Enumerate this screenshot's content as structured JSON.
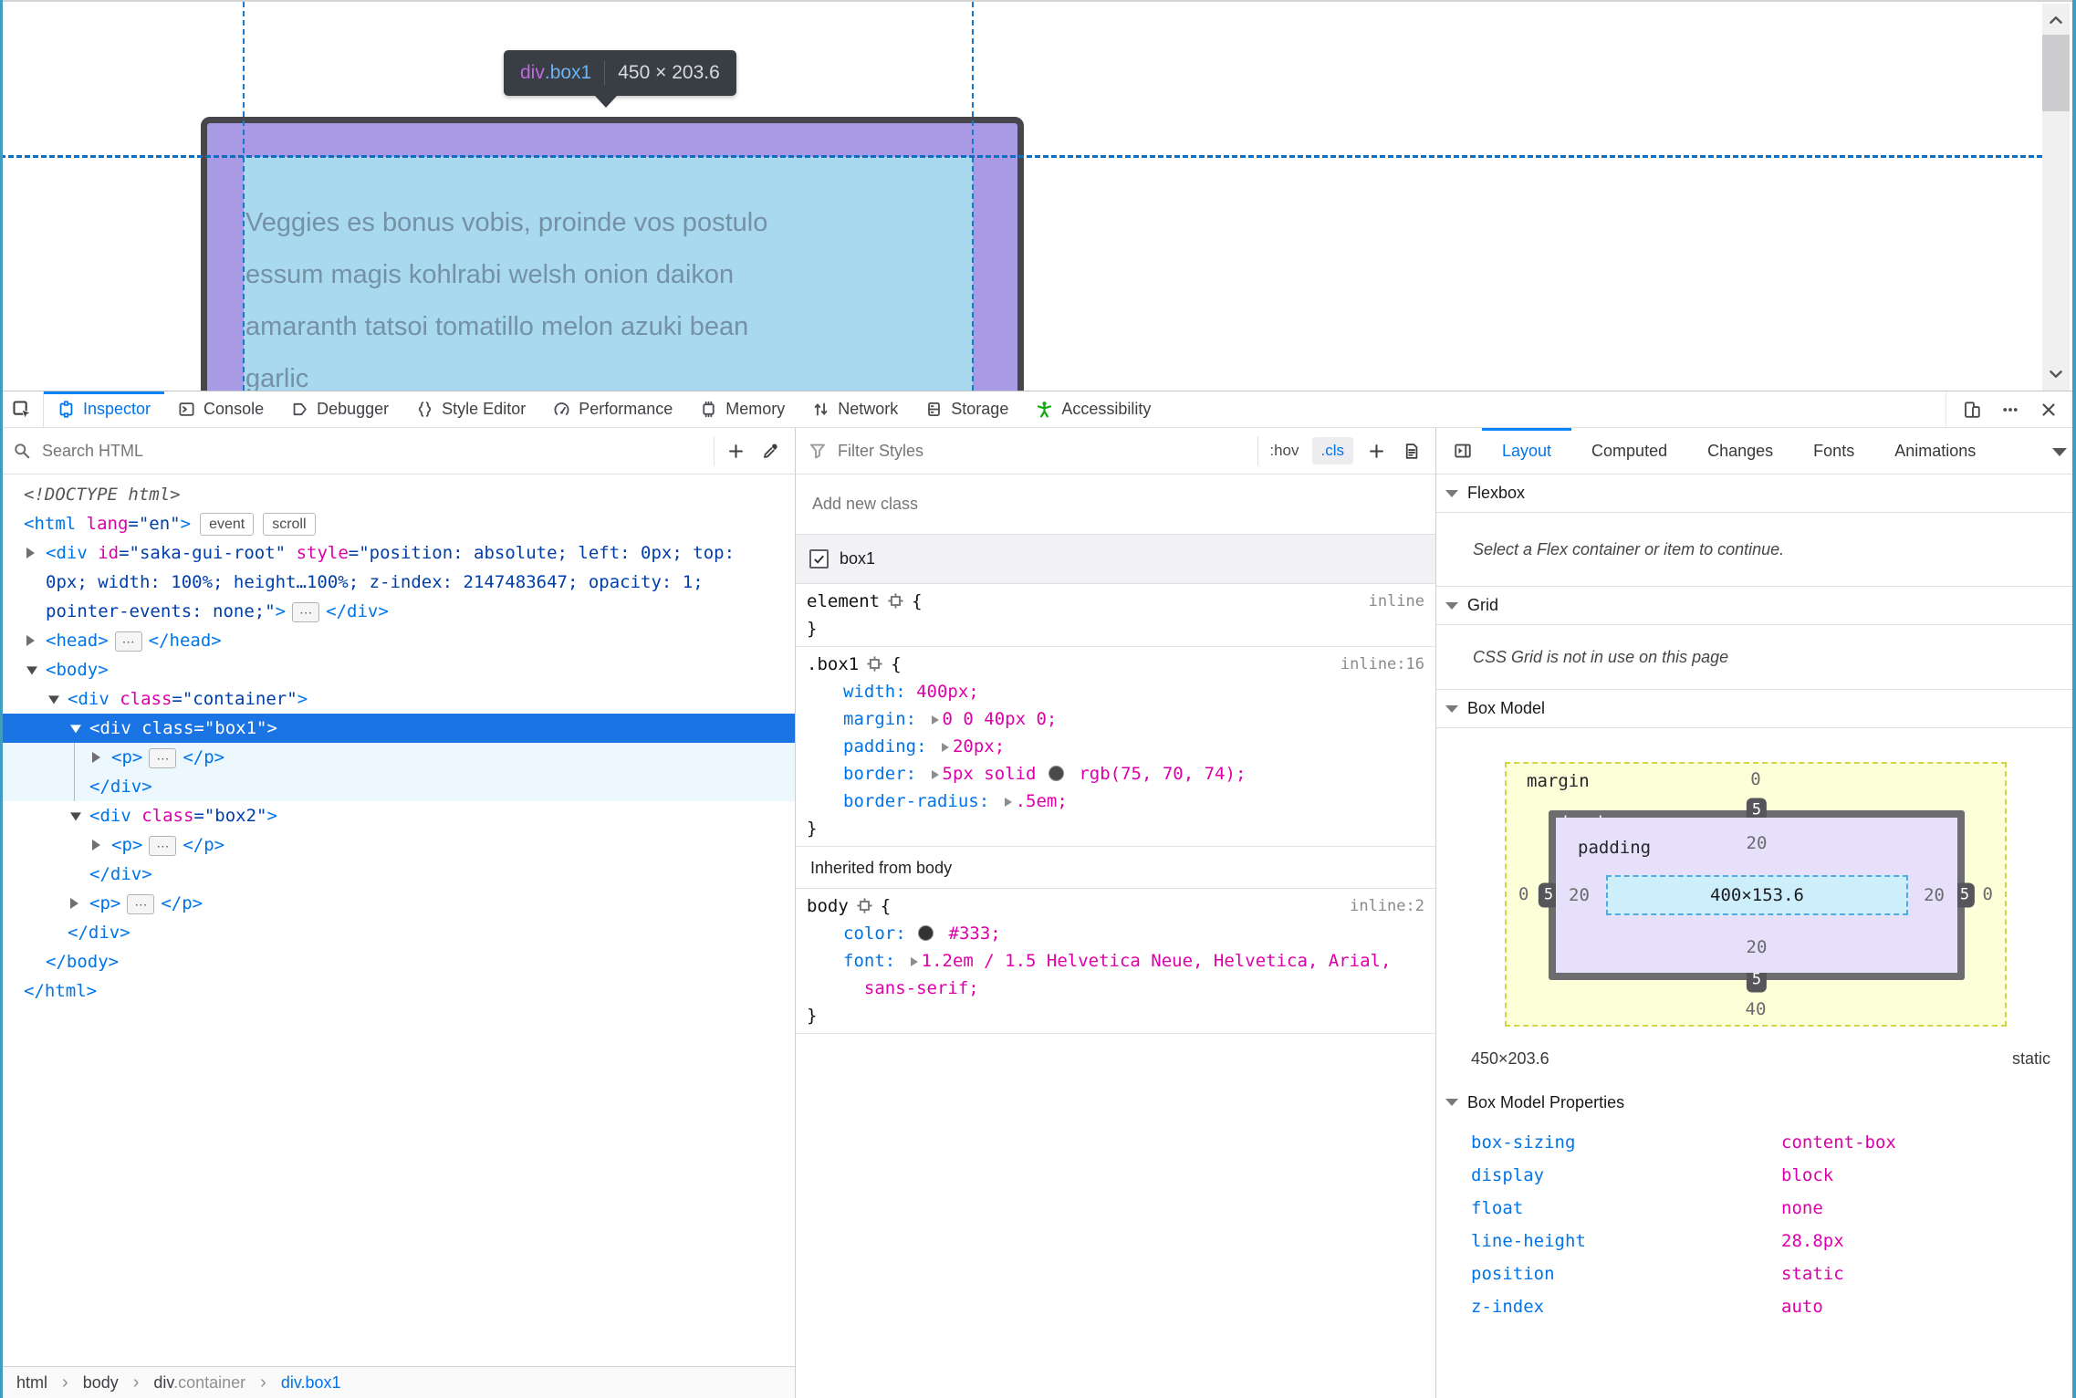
{
  "colors": {
    "accent_blue": "#0074e8",
    "active_stripe": "#0a84ff",
    "magenta": "#dd00a9",
    "attr_value_navy": "#003eaa",
    "selected_row_bg": "#1b74e4",
    "accessibility_green": "#0fab0f",
    "overlay_padding_purple": "#a89ae4",
    "overlay_content_blue": "#a9d9ef",
    "page_box_border": "#47464a",
    "highlighter_guide": "#1a78c8",
    "boxmodel_margin_fill": "#fcffd8",
    "boxmodel_border_fill": "#6d6d70",
    "boxmodel_padding_fill": "#e6e0fb",
    "boxmodel_content_fill": "#cdeefb"
  },
  "viewport": {
    "tooltip": {
      "tag": "div",
      "cls": ".box1",
      "dims": "450 × 203.6"
    },
    "page_text_lines": [
      "Veggies es bonus vobis, proinde vos postulo",
      "essum magis kohlrabi welsh onion daikon",
      "amaranth tatsoi tomatillo melon azuki bean",
      "garlic"
    ]
  },
  "toolbar": {
    "picker_icon": "node-picker-icon",
    "tabs": [
      {
        "label": "Inspector",
        "icon": "inspector-icon",
        "active": true
      },
      {
        "label": "Console",
        "icon": "console-icon"
      },
      {
        "label": "Debugger",
        "icon": "debugger-icon"
      },
      {
        "label": "Style Editor",
        "icon": "style-editor-icon"
      },
      {
        "label": "Performance",
        "icon": "performance-icon"
      },
      {
        "label": "Memory",
        "icon": "memory-icon"
      },
      {
        "label": "Network",
        "icon": "network-icon"
      },
      {
        "label": "Storage",
        "icon": "storage-icon"
      },
      {
        "label": "Accessibility",
        "icon": "accessibility-icon",
        "icon_color": "#0fab0f"
      }
    ],
    "right_icons": [
      "responsive-design-icon",
      "meatball-menu-icon",
      "close-icon"
    ]
  },
  "markup_panel": {
    "search_placeholder": "Search HTML",
    "action_icons": [
      "add-node-icon",
      "eyedropper-icon"
    ],
    "ellipsis_glyph": "⋯",
    "lines": [
      {
        "indent": 0,
        "tokens": [
          {
            "k": "doctype",
            "x": "<!DOCTYPE html>"
          }
        ]
      },
      {
        "indent": 0,
        "tokens": [
          {
            "k": "tag",
            "x": "<html"
          },
          {
            "k": "attr",
            "x": " lang"
          },
          {
            "k": "val",
            "x": "=\"en\""
          },
          {
            "k": "tag",
            "x": ">"
          },
          {
            "k": "badge",
            "x": "event"
          },
          {
            "k": "badge",
            "x": "scroll"
          }
        ]
      },
      {
        "indent": 1,
        "arrow": "collapsed",
        "tokens": [
          {
            "k": "tag",
            "x": "<div"
          },
          {
            "k": "attr",
            "x": " id"
          },
          {
            "k": "val",
            "x": "=\"saka-gui-root\""
          },
          {
            "k": "attr",
            "x": " style"
          },
          {
            "k": "val",
            "x": "=\"position: absolute; left: 0px; top:"
          }
        ]
      },
      {
        "indent": 1,
        "tokens": [
          {
            "k": "val",
            "x": "0px; width: 100%; height…100%; z-index: 2147483647; opacity: 1;"
          }
        ]
      },
      {
        "indent": 1,
        "tokens": [
          {
            "k": "val",
            "x": "pointer-events: none;\""
          },
          {
            "k": "tag",
            "x": ">"
          },
          {
            "k": "dots"
          },
          {
            "k": "tag",
            "x": "</div>"
          }
        ]
      },
      {
        "indent": 1,
        "arrow": "collapsed",
        "tokens": [
          {
            "k": "tag",
            "x": "<head>"
          },
          {
            "k": "dots"
          },
          {
            "k": "tag",
            "x": "</head>"
          }
        ]
      },
      {
        "indent": 1,
        "arrow": "expanded",
        "tokens": [
          {
            "k": "tag",
            "x": "<body>"
          }
        ]
      },
      {
        "indent": 2,
        "arrow": "expanded",
        "tokens": [
          {
            "k": "tag",
            "x": "<div"
          },
          {
            "k": "attr",
            "x": " class"
          },
          {
            "k": "val",
            "x": "=\"container\""
          },
          {
            "k": "tag",
            "x": ">"
          }
        ]
      },
      {
        "indent": 3,
        "arrow": "expanded",
        "selected": true,
        "tokens": [
          {
            "k": "tag",
            "x": "<div"
          },
          {
            "k": "attr",
            "x": " class"
          },
          {
            "k": "val",
            "x": "=\"box1\""
          },
          {
            "k": "tag",
            "x": ">"
          }
        ]
      },
      {
        "indent": 4,
        "arrow": "collapsed",
        "shaded": true,
        "guide": true,
        "tokens": [
          {
            "k": "tag",
            "x": "<p>"
          },
          {
            "k": "dots"
          },
          {
            "k": "tag",
            "x": "</p>"
          }
        ]
      },
      {
        "indent": 3,
        "shaded": true,
        "guide": true,
        "tokens": [
          {
            "k": "tag",
            "x": "</div>"
          }
        ]
      },
      {
        "indent": 3,
        "arrow": "expanded",
        "tokens": [
          {
            "k": "tag",
            "x": "<div"
          },
          {
            "k": "attr",
            "x": " class"
          },
          {
            "k": "val",
            "x": "=\"box2\""
          },
          {
            "k": "tag",
            "x": ">"
          }
        ]
      },
      {
        "indent": 4,
        "arrow": "collapsed",
        "tokens": [
          {
            "k": "tag",
            "x": "<p>"
          },
          {
            "k": "dots"
          },
          {
            "k": "tag",
            "x": "</p>"
          }
        ]
      },
      {
        "indent": 3,
        "tokens": [
          {
            "k": "tag",
            "x": "</div>"
          }
        ]
      },
      {
        "indent": 3,
        "arrow": "collapsed",
        "tokens": [
          {
            "k": "tag",
            "x": "<p>"
          },
          {
            "k": "dots"
          },
          {
            "k": "tag",
            "x": "</p>"
          }
        ]
      },
      {
        "indent": 2,
        "tokens": [
          {
            "k": "tag",
            "x": "</div>"
          }
        ]
      },
      {
        "indent": 1,
        "tokens": [
          {
            "k": "tag",
            "x": "</body>"
          }
        ]
      },
      {
        "indent": 0,
        "tokens": [
          {
            "k": "tag",
            "x": "</html>"
          }
        ]
      }
    ]
  },
  "rules_panel": {
    "filter_placeholder": "Filter Styles",
    "pseudo_label": ":hov",
    "class_label": ".cls",
    "action_icons": [
      "add-rule-icon",
      "print-media-icon"
    ],
    "add_class_placeholder": "Add new class",
    "class_toggle": {
      "checked": true,
      "name": "box1"
    },
    "rules": [
      {
        "selector": "element",
        "location": "inline",
        "properties": []
      },
      {
        "selector": ".box1",
        "location": "inline:16",
        "properties": [
          {
            "name": "width",
            "value": [
              {
                "t": "400px"
              }
            ]
          },
          {
            "name": "margin",
            "exp": true,
            "value": [
              {
                "t": "0 0 40px 0"
              }
            ]
          },
          {
            "name": "padding",
            "exp": true,
            "value": [
              {
                "t": "20px"
              }
            ]
          },
          {
            "name": "border",
            "exp": true,
            "value": [
              {
                "t": "5px solid "
              },
              {
                "swatch": "#4b4a4a"
              },
              {
                "t": " rgb(75, 70, 74)"
              }
            ]
          },
          {
            "name": "border-radius",
            "exp": true,
            "value": [
              {
                "t": ".5em"
              }
            ]
          }
        ]
      }
    ],
    "inherited_header": "Inherited from body",
    "inherited_rules": [
      {
        "selector": "body",
        "location": "inline:2",
        "properties": [
          {
            "name": "color",
            "value": [
              {
                "swatch": "#333333"
              },
              {
                "t": " #333"
              }
            ]
          },
          {
            "name": "font",
            "exp": true,
            "value": [
              {
                "t": "1.2em / 1.5 Helvetica Neue, Helvetica, Arial,\n  sans-serif"
              }
            ]
          }
        ]
      }
    ]
  },
  "layout_panel": {
    "toggle_icon": "sidebar-toggle-icon",
    "tabs": [
      {
        "label": "Layout",
        "active": true
      },
      {
        "label": "Computed"
      },
      {
        "label": "Changes"
      },
      {
        "label": "Fonts"
      },
      {
        "label": "Animations",
        "truncated": true
      }
    ],
    "sections": {
      "flexbox": {
        "title": "Flexbox",
        "message": "Select a Flex container or item to continue."
      },
      "grid": {
        "title": "Grid",
        "message": "CSS Grid is not in use on this page"
      },
      "box_model": {
        "title": "Box Model"
      }
    },
    "box_model": {
      "margin_label": "margin",
      "border_label": "border",
      "padding_label": "padding",
      "margin": {
        "top": "0",
        "right": "0",
        "bottom": "40",
        "left": "0"
      },
      "border": {
        "top": "5",
        "right": "5",
        "bottom": "5",
        "left": "5"
      },
      "padding": {
        "top": "20",
        "right": "20",
        "bottom": "20",
        "left": "20"
      },
      "content": "400×153.6",
      "total": "450×203.6",
      "position": "static"
    },
    "properties_header": "Box Model Properties",
    "properties": [
      [
        "box-sizing",
        "content-box"
      ],
      [
        "display",
        "block"
      ],
      [
        "float",
        "none"
      ],
      [
        "line-height",
        "28.8px"
      ],
      [
        "position",
        "static"
      ],
      [
        "z-index",
        "auto"
      ]
    ]
  },
  "breadcrumb": [
    {
      "parts": [
        {
          "t": "html"
        }
      ]
    },
    {
      "parts": [
        {
          "t": "body"
        }
      ]
    },
    {
      "parts": [
        {
          "t": "div"
        },
        {
          "t": ".container",
          "muted": true
        }
      ]
    },
    {
      "parts": [
        {
          "t": "div.box1"
        }
      ],
      "active": true
    },
    {
      "separator": "›"
    }
  ]
}
